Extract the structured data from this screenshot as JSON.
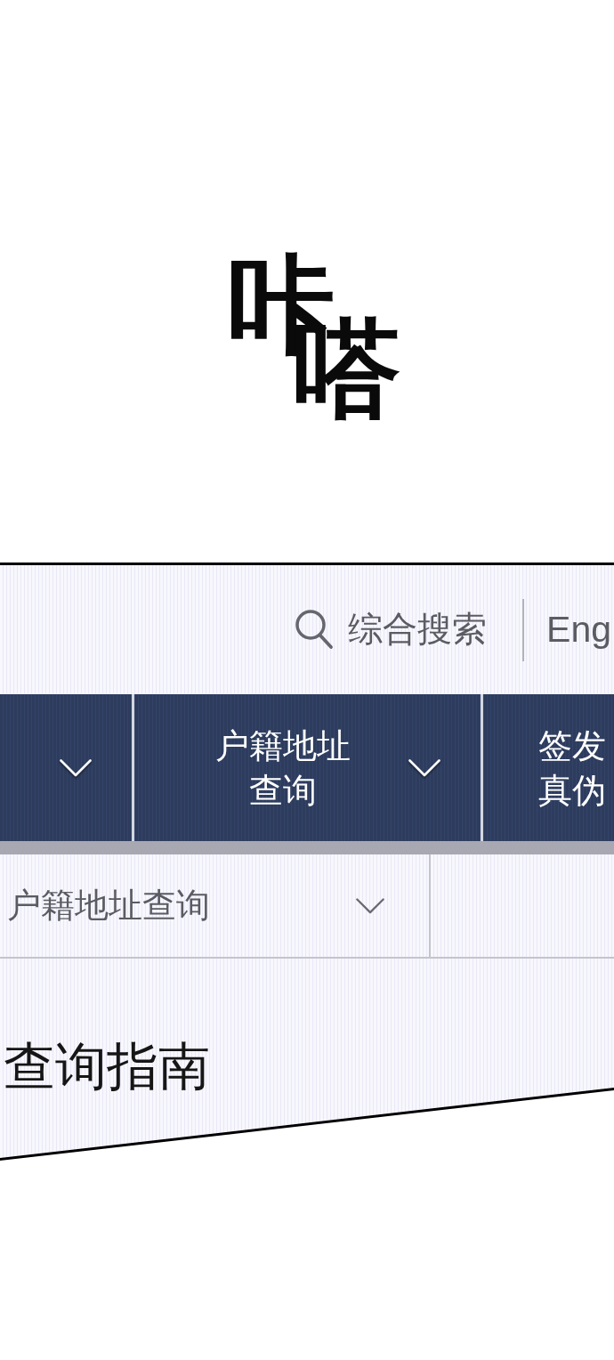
{
  "sound_effect": {
    "text": "咔嗒"
  },
  "header": {
    "search": {
      "label": "综合搜索"
    },
    "language": {
      "label": "Eng"
    }
  },
  "nav_tabs": [
    {
      "expandable": true
    },
    {
      "lines": [
        "户籍地址",
        "查询"
      ],
      "expandable": true
    },
    {
      "lines": [
        "签发",
        "真伪"
      ],
      "expandable": false
    }
  ],
  "subnav": {
    "dropdown": {
      "value": "户籍地址查询"
    }
  },
  "heading": "查询指南"
}
